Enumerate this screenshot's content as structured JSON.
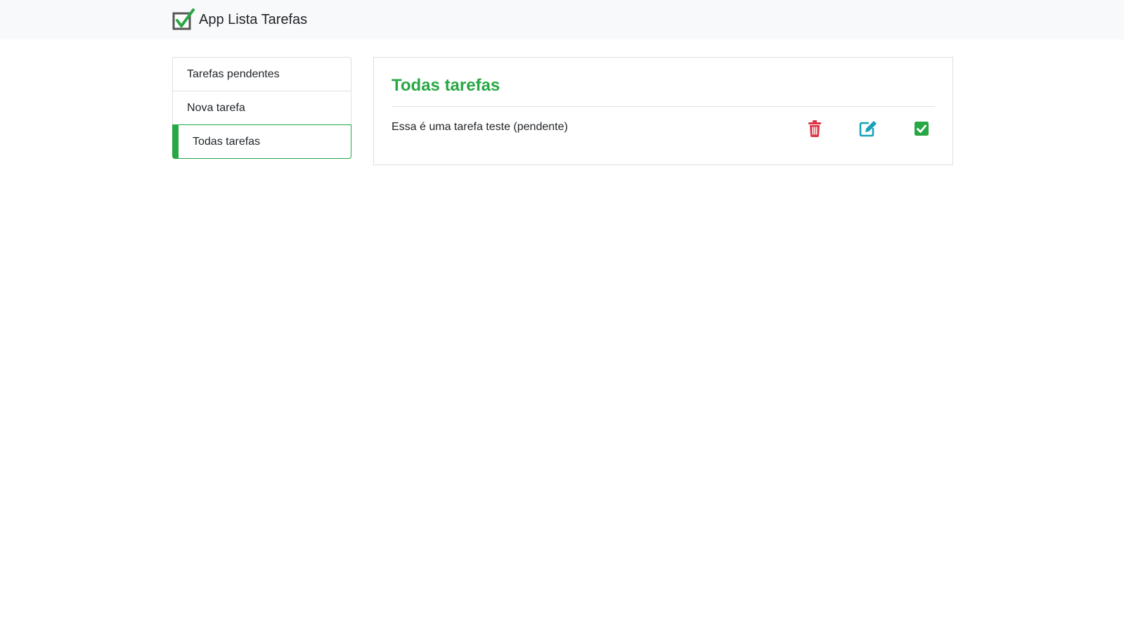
{
  "header": {
    "brand_title": "App Lista Tarefas",
    "logo_icon": "checkbox-logo-icon"
  },
  "sidebar": {
    "items": [
      {
        "label": "Tarefas pendentes",
        "active": false
      },
      {
        "label": "Nova tarefa",
        "active": false
      },
      {
        "label": "Todas tarefas",
        "active": true
      }
    ]
  },
  "main": {
    "title": "Todas tarefas",
    "tasks": [
      {
        "text": "Essa é uma tarefa teste (pendente)",
        "actions": [
          {
            "icon": "trash-icon",
            "color": "#dc3545"
          },
          {
            "icon": "edit-icon",
            "color": "#17a2b8"
          },
          {
            "icon": "check-square-icon",
            "color": "#28a745"
          }
        ]
      }
    ]
  },
  "colors": {
    "accent": "#28a745",
    "danger": "#dc3545",
    "info": "#17a2b8",
    "navbar_bg": "#f8f9fa"
  }
}
